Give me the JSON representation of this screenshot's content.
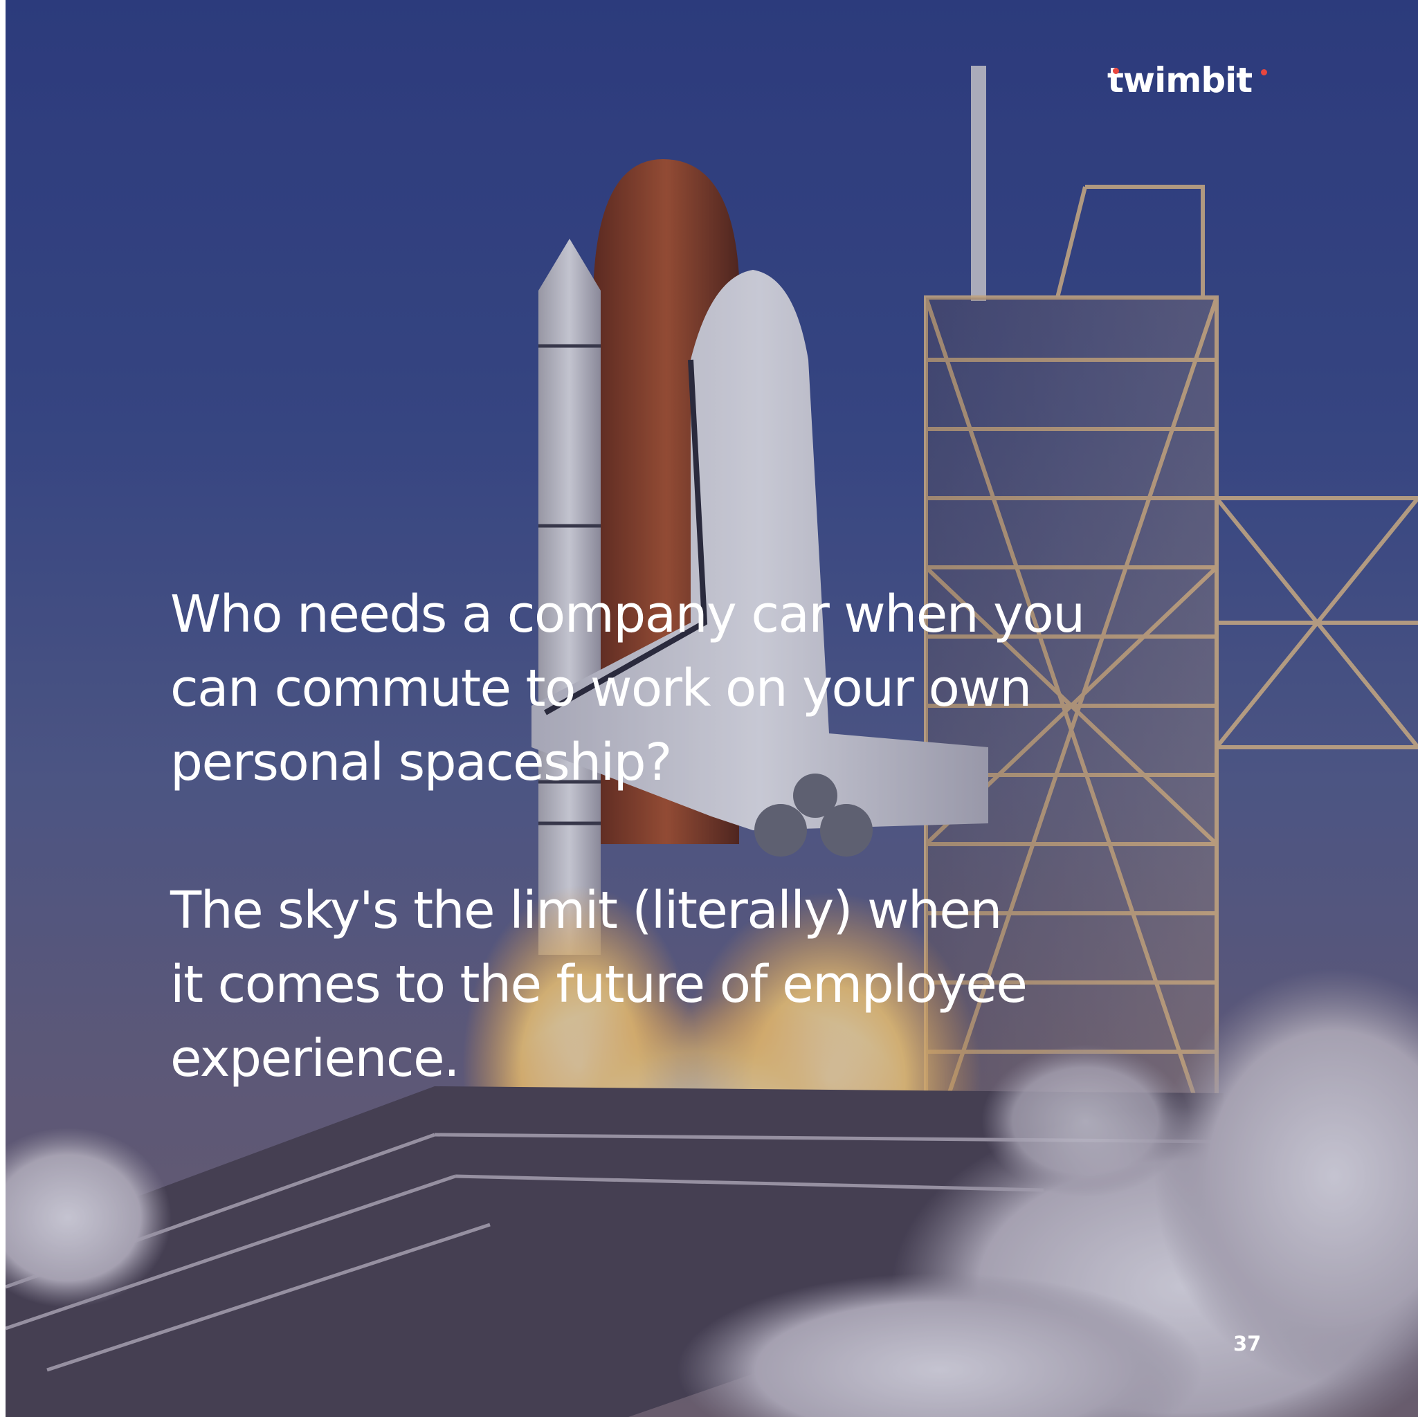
{
  "brand": {
    "logo_text": "twimbit",
    "accent_color": "#e8463f"
  },
  "content": {
    "paragraph_1": "Who needs a company car when you\ncan commute to work on your own\npersonal spaceship?",
    "paragraph_2": "The sky's the limit (literally) when\nit comes to the future of employee\nexperience."
  },
  "page": {
    "number": "37"
  },
  "background": {
    "image_description_icon": "space-shuttle-launch-photo"
  }
}
